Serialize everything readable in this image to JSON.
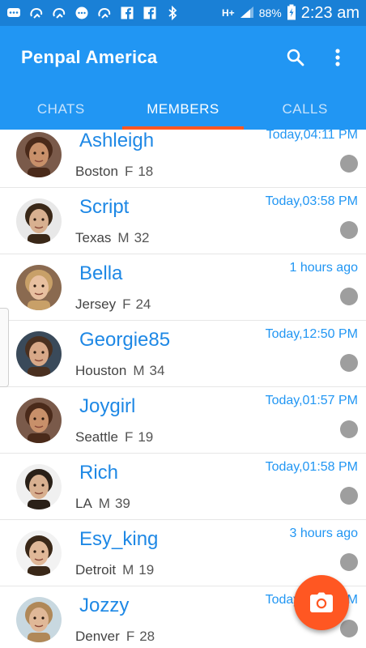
{
  "status_bar": {
    "battery": "88%",
    "network": "H+",
    "time": "2:23 am",
    "icons": [
      "message-icon",
      "recycle-icon",
      "recycle-icon",
      "chat-bubble-icon",
      "recycle-icon",
      "facebook-icon",
      "facebook-icon",
      "bluetooth-icon",
      "network-icon",
      "signal-icon",
      "battery-icon"
    ]
  },
  "app_bar": {
    "title": "Penpal America",
    "actions": [
      "search-icon",
      "more-vert-icon"
    ]
  },
  "tabs": [
    {
      "label": "CHATS",
      "active": false
    },
    {
      "label": "MEMBERS",
      "active": true
    },
    {
      "label": "CALLS",
      "active": false
    }
  ],
  "members": [
    {
      "name": "Ashleigh",
      "city": "Boston",
      "gender": "F",
      "age": "18",
      "time": "Today,04:11 PM",
      "online": false,
      "skin": "#c8906a",
      "hair": "#4a2a1a",
      "bg": "#7a5a4a"
    },
    {
      "name": "Script",
      "city": "Texas",
      "gender": "M",
      "age": "32",
      "time": "Today,03:58 PM",
      "online": false,
      "skin": "#d8b090",
      "hair": "#3a2818",
      "bg": "#e8e8e8"
    },
    {
      "name": "Bella",
      "city": "Jersey",
      "gender": "F",
      "age": "24",
      "time": "1 hours ago",
      "online": false,
      "skin": "#e8c0a0",
      "hair": "#c8a068",
      "bg": "#8a6a50"
    },
    {
      "name": "Georgie85",
      "city": "Houston",
      "gender": "M",
      "age": "34",
      "time": "Today,12:50 PM",
      "online": false,
      "skin": "#d8a888",
      "hair": "#4a3020",
      "bg": "#3a4a5a"
    },
    {
      "name": "Joygirl",
      "city": "Seattle",
      "gender": "F",
      "age": "19",
      "time": "Today,01:57 PM",
      "online": false,
      "skin": "#c8906a",
      "hair": "#4a2a1a",
      "bg": "#7a5a4a"
    },
    {
      "name": "Rich",
      "city": "LA",
      "gender": "M",
      "age": "39",
      "time": "Today,01:58 PM",
      "online": false,
      "skin": "#d8b090",
      "hair": "#2a2018",
      "bg": "#f0f0f0"
    },
    {
      "name": "Esy_king",
      "city": "Detroit",
      "gender": "M",
      "age": "19",
      "time": "3 hours ago",
      "online": false,
      "skin": "#e0b898",
      "hair": "#3a2818",
      "bg": "#f2f2f2"
    },
    {
      "name": "Jozzy",
      "city": "Denver",
      "gender": "F",
      "age": "28",
      "time": "Today,04:02 PM",
      "online": false,
      "skin": "#e0b898",
      "hair": "#b08858",
      "bg": "#c8d8e0"
    }
  ],
  "fab": {
    "icon": "camera-icon"
  },
  "colors": {
    "primary": "#2196f3",
    "status": "#1a80d6",
    "accent": "#ff5722",
    "name": "#1e88e5"
  }
}
